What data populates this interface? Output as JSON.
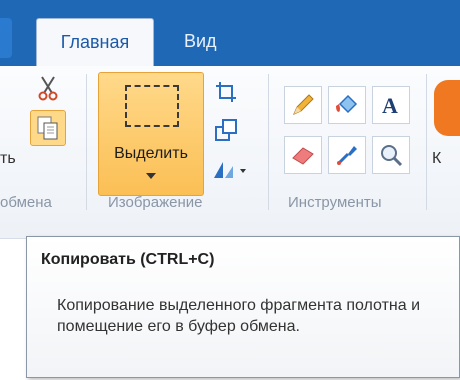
{
  "tabs": {
    "home": "Главная",
    "view": "Вид"
  },
  "groups": {
    "clipboard": "обмена",
    "image": "Изображение",
    "tools": "Инструменты"
  },
  "clipboard": {
    "paste_stub": "ть"
  },
  "image": {
    "select_label": "Выделить"
  },
  "right_stub": "К",
  "tooltip": {
    "title": "Копировать (CTRL+C)",
    "body": "Копирование выделенного фрагмента полотна и помещение его в буфер обмена."
  },
  "colors": {
    "ribbon_bar": "#1f68b5",
    "select_highlight": "#fbbf55"
  },
  "icons": [
    "scissors-icon",
    "copy-icon",
    "crop-icon",
    "resize-icon",
    "rotate-icon",
    "pencil-icon",
    "fill-icon",
    "text-icon",
    "eraser-icon",
    "color-picker-icon",
    "magnifier-icon"
  ]
}
